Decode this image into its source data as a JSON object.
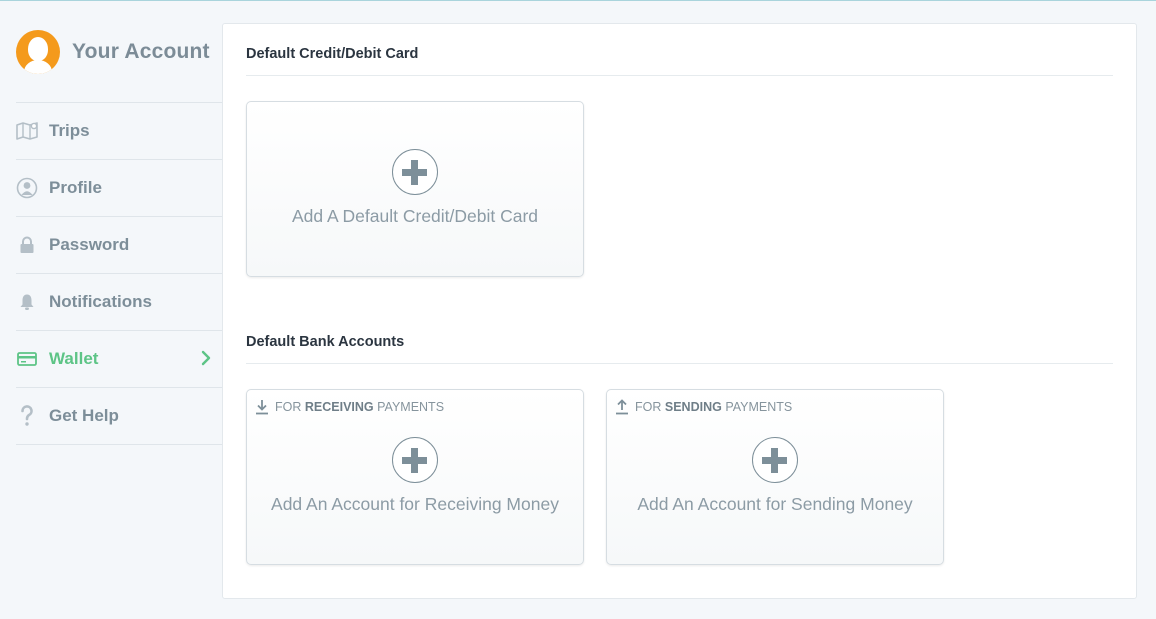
{
  "sidebar": {
    "title": "Your Account",
    "items": [
      {
        "label": "Trips",
        "icon": "map-icon"
      },
      {
        "label": "Profile",
        "icon": "user-circle-icon"
      },
      {
        "label": "Password",
        "icon": "lock-icon"
      },
      {
        "label": "Notifications",
        "icon": "bell-icon"
      },
      {
        "label": "Wallet",
        "icon": "credit-card-icon",
        "active": true
      },
      {
        "label": "Get Help",
        "icon": "question-icon"
      }
    ]
  },
  "main": {
    "credit_section": {
      "title": "Default Credit/Debit Card",
      "card_label": "Add A Default Credit/Debit Card"
    },
    "bank_section": {
      "title": "Default Bank Accounts",
      "receiving": {
        "tag_prefix": "FOR",
        "tag_bold": "RECEIVING",
        "tag_suffix": "PAYMENTS",
        "card_label": "Add An Account for Receiving Money"
      },
      "sending": {
        "tag_prefix": "FOR",
        "tag_bold": "SENDING",
        "tag_suffix": "PAYMENTS",
        "card_label": "Add An Account for Sending Money"
      }
    }
  },
  "colors": {
    "accent": "#5dc486",
    "avatar": "#f49a1c",
    "background": "#f4f7fa"
  }
}
